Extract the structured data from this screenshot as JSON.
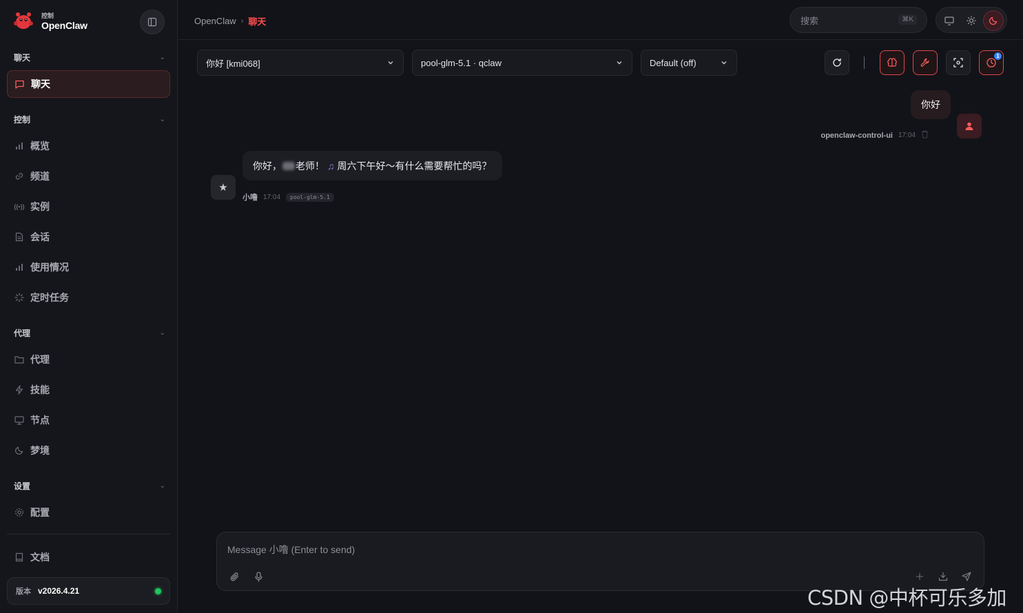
{
  "brand": {
    "sub": "控制",
    "name": "OpenClaw"
  },
  "sidebar": {
    "sections": [
      {
        "title": "聊天"
      },
      {
        "title": "控制"
      },
      {
        "title": "代理"
      },
      {
        "title": "设置"
      }
    ],
    "active_item": "聊天",
    "control_items": [
      "概览",
      "频道",
      "实例",
      "会话",
      "使用情况",
      "定时任务"
    ],
    "agent_items": [
      "代理",
      "技能",
      "节点",
      "梦境"
    ],
    "settings_items": [
      "配置"
    ],
    "docs": "文档",
    "version_label": "版本",
    "version_value": "v2026.4.21"
  },
  "topbar": {
    "breadcrumb_root": "OpenClaw",
    "breadcrumb_sep": "›",
    "breadcrumb_current": "聊天",
    "search_placeholder": "搜索",
    "search_shortcut": "⌘K"
  },
  "toolbar": {
    "session_select": "你好 [kmi068]",
    "model_select": "pool-glm-5.1 · qclaw",
    "thinking_select": "Default (off)",
    "notification_count": "1"
  },
  "messages": {
    "user": {
      "text": "你好",
      "sender": "openclaw-control-ui",
      "time": "17:04"
    },
    "bot": {
      "text_before": "你好，",
      "text_after": "老师！",
      "text_rest": "周六下午好～有什么需要帮忙的吗？",
      "sender": "小噜",
      "time": "17:04",
      "model": "pool-glm-5.1"
    }
  },
  "composer": {
    "placeholder": "Message 小噜 (Enter to send)"
  },
  "watermark": "CSDN @中杯可乐多加冰",
  "colors": {
    "accent": "#ff4d4d",
    "status": "#22c55e",
    "badge": "#3b82f6"
  }
}
